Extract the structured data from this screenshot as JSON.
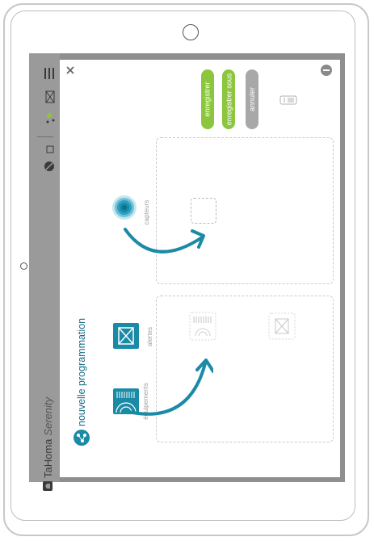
{
  "app": {
    "brand": "TaHoma",
    "brand_suffix": "Serenity"
  },
  "panel": {
    "title": "nouvelle programmation"
  },
  "toolbar": {
    "save_label": "enregistrer",
    "save_as_label": "enregistrer sous",
    "cancel_label": "annuler"
  },
  "palette": {
    "sensors_label": "capteurs",
    "alerts_label": "alertes",
    "equipment_label": "équipements"
  },
  "colors": {
    "accent_green": "#8cc63f",
    "brand_teal": "#1a8aa6",
    "cancel_gray": "#a8a8a8"
  },
  "icons": [
    "menu-icon",
    "mail-icon",
    "network-icon",
    "camera-icon",
    "disabled-icon",
    "close-icon",
    "collapse-icon",
    "list-icon",
    "sensor-icon",
    "alert-icon",
    "equipment-icon",
    "arrow-icon",
    "home-logo-icon"
  ]
}
